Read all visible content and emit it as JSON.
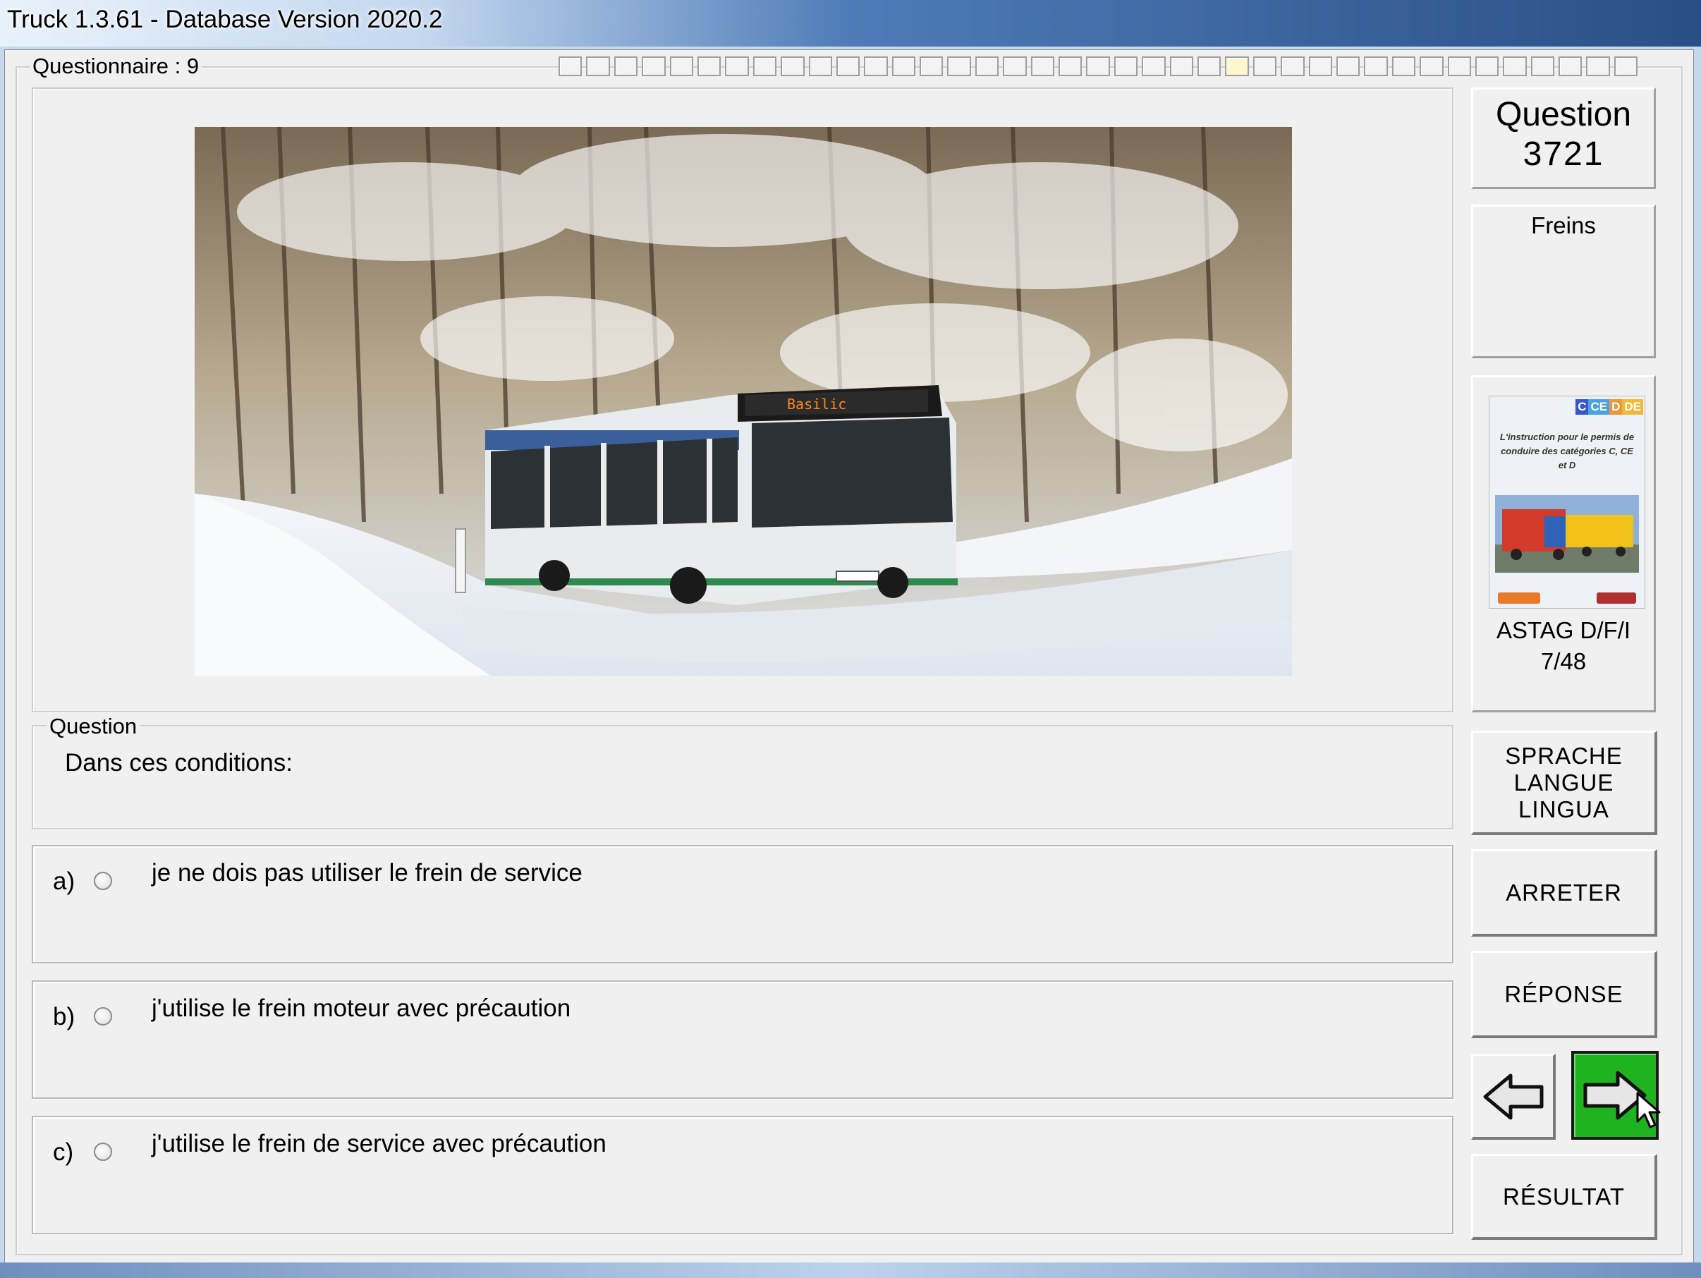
{
  "window": {
    "title": "Truck 1.3.61 - Database Version 2020.2"
  },
  "questionnaire": {
    "label": "Questionnaire : 9",
    "progress_total": 39,
    "progress_current": 24
  },
  "question": {
    "legend": "Question",
    "text": "Dans ces conditions:",
    "header_word": "Question",
    "number": "3721",
    "category": "Freins"
  },
  "answers": [
    {
      "letter": "a)",
      "text": "je ne dois pas utiliser le frein de service",
      "selected": false
    },
    {
      "letter": "b)",
      "text": "j'utilise le frein moteur avec précaution",
      "selected": false
    },
    {
      "letter": "c)",
      "text": "j'utilise le frein de service avec précaution",
      "selected": false
    }
  ],
  "book": {
    "badges": [
      "C",
      "CE",
      "D",
      "DE"
    ],
    "cover_text": "L'instruction pour le permis de conduire des catégories C, CE et D",
    "label": "ASTAG D/F/I",
    "page": "7/48"
  },
  "buttons": {
    "language": "SPRACHE\nLANGUE\nLINGUA",
    "stop": "ARRETER",
    "answer": "RÉPONSE",
    "result": "RÉSULTAT"
  },
  "icons": {
    "prev": "arrow-left-icon",
    "next": "arrow-right-icon",
    "next_color": "#1fb31f"
  }
}
